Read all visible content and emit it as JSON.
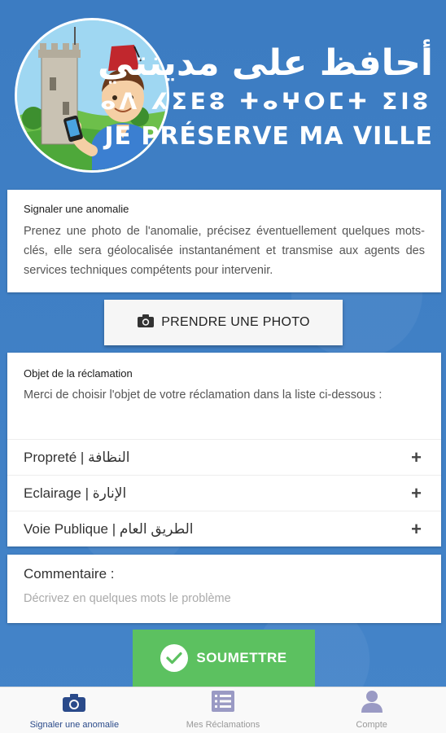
{
  "header": {
    "title_arabic": "أحافظ على مدينتي",
    "title_tifinagh": "ⴰⴷ ⵃⵉⴹⵓ ⵜⴰⵖⵔⵎⵜ ⵉⵏⵓ",
    "title_french": "JE PRÉSERVE MA VILLE"
  },
  "info_card": {
    "title": "Signaler une anomalie",
    "text": "Prenez une photo de l'anomalie, précisez éventuellement quelques mots-clés, elle sera géolocalisée instantanément et transmise aux agents des services techniques compétents pour intervenir."
  },
  "photo_button": {
    "label": "PRENDRE UNE PHOTO",
    "icon": "camera-icon"
  },
  "object_card": {
    "title": "Objet de la réclamation",
    "description": "Merci de choisir l'objet de votre réclamation dans la liste ci-dessous :",
    "items": [
      {
        "label": "Propreté | النظافة",
        "icon": "plus-icon",
        "symbol": "+"
      },
      {
        "label": "Eclairage | الإنارة",
        "icon": "plus-icon",
        "symbol": "+"
      },
      {
        "label": "Voie Publique | الطريق العام",
        "icon": "plus-icon",
        "symbol": "+"
      }
    ]
  },
  "comment_card": {
    "label": "Commentaire :",
    "placeholder": "Décrivez en quelques mots le problème",
    "value": ""
  },
  "submit_button": {
    "label": "SOUMETTRE",
    "icon": "check-circle-icon"
  },
  "bottom_nav": {
    "items": [
      {
        "label": "Signaler une anomalie",
        "icon": "camera-icon",
        "active": true
      },
      {
        "label": "Mes Réclamations",
        "icon": "list-icon",
        "active": false
      },
      {
        "label": "Compte",
        "icon": "user-icon",
        "active": false
      }
    ]
  },
  "colors": {
    "background": "#3f7fc4",
    "submit": "#5cc160",
    "nav_active": "#2a4a8a",
    "nav_inactive": "#999999"
  }
}
